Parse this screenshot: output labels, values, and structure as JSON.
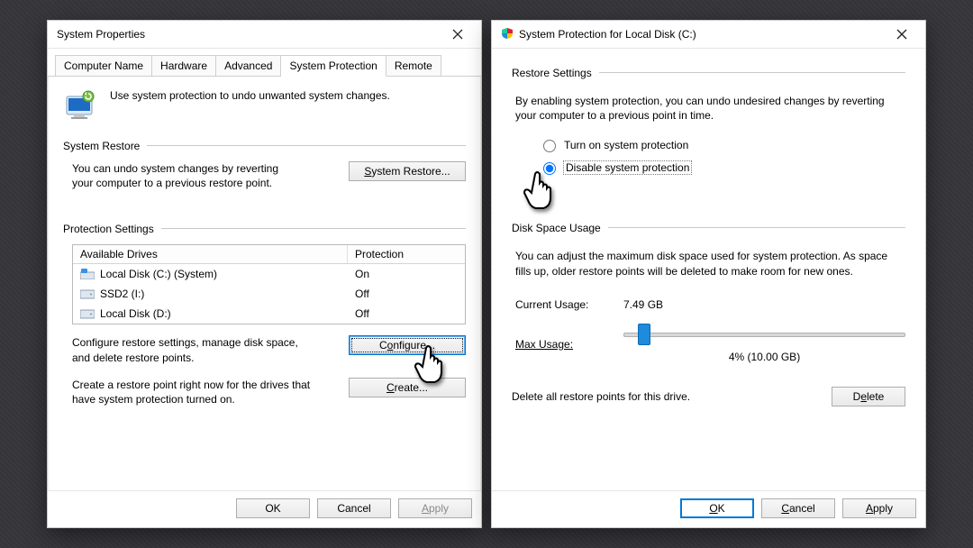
{
  "win1": {
    "title": "System Properties",
    "tabs": [
      "Computer Name",
      "Hardware",
      "Advanced",
      "System Protection",
      "Remote"
    ],
    "selected_tab_index": 3,
    "hint": "Use system protection to undo unwanted system changes.",
    "group_restore": "System Restore",
    "restore_text": "You can undo system changes by reverting your computer to a previous restore point.",
    "restore_btn": "System Restore...",
    "group_protection": "Protection Settings",
    "drives_header_name": "Available Drives",
    "drives_header_prot": "Protection",
    "drives": [
      {
        "name": "Local Disk (C:) (System)",
        "protection": "On",
        "kind": "system"
      },
      {
        "name": "SSD2 (I:)",
        "protection": "Off",
        "kind": "hdd"
      },
      {
        "name": "Local Disk (D:)",
        "protection": "Off",
        "kind": "hdd"
      }
    ],
    "configure_text": "Configure restore settings, manage disk space, and delete restore points.",
    "configure_btn": "Configure...",
    "create_text": "Create a restore point right now for the drives that have system protection turned on.",
    "create_btn": "Create...",
    "ok": "OK",
    "cancel": "Cancel",
    "apply": "Apply"
  },
  "win2": {
    "title": "System Protection for Local Disk (C:)",
    "group_restore": "Restore Settings",
    "restore_text": "By enabling system protection, you can undo undesired changes by reverting your computer to a previous point in time.",
    "radio_on": "Turn on system protection",
    "radio_off": "Disable system protection",
    "radio_selected": "off",
    "group_disk": "Disk Space Usage",
    "disk_text": "You can adjust the maximum disk space used for system protection. As space fills up, older restore points will be deleted to make room for new ones.",
    "current_usage_label": "Current Usage:",
    "current_usage_value": "7.49 GB",
    "max_usage_label": "Max Usage:",
    "max_usage_value_pct": 4,
    "max_usage_value_text": "4% (10.00 GB)",
    "delete_text": "Delete all restore points for this drive.",
    "delete_btn": "Delete",
    "ok": "OK",
    "cancel": "Cancel",
    "apply": "Apply"
  }
}
